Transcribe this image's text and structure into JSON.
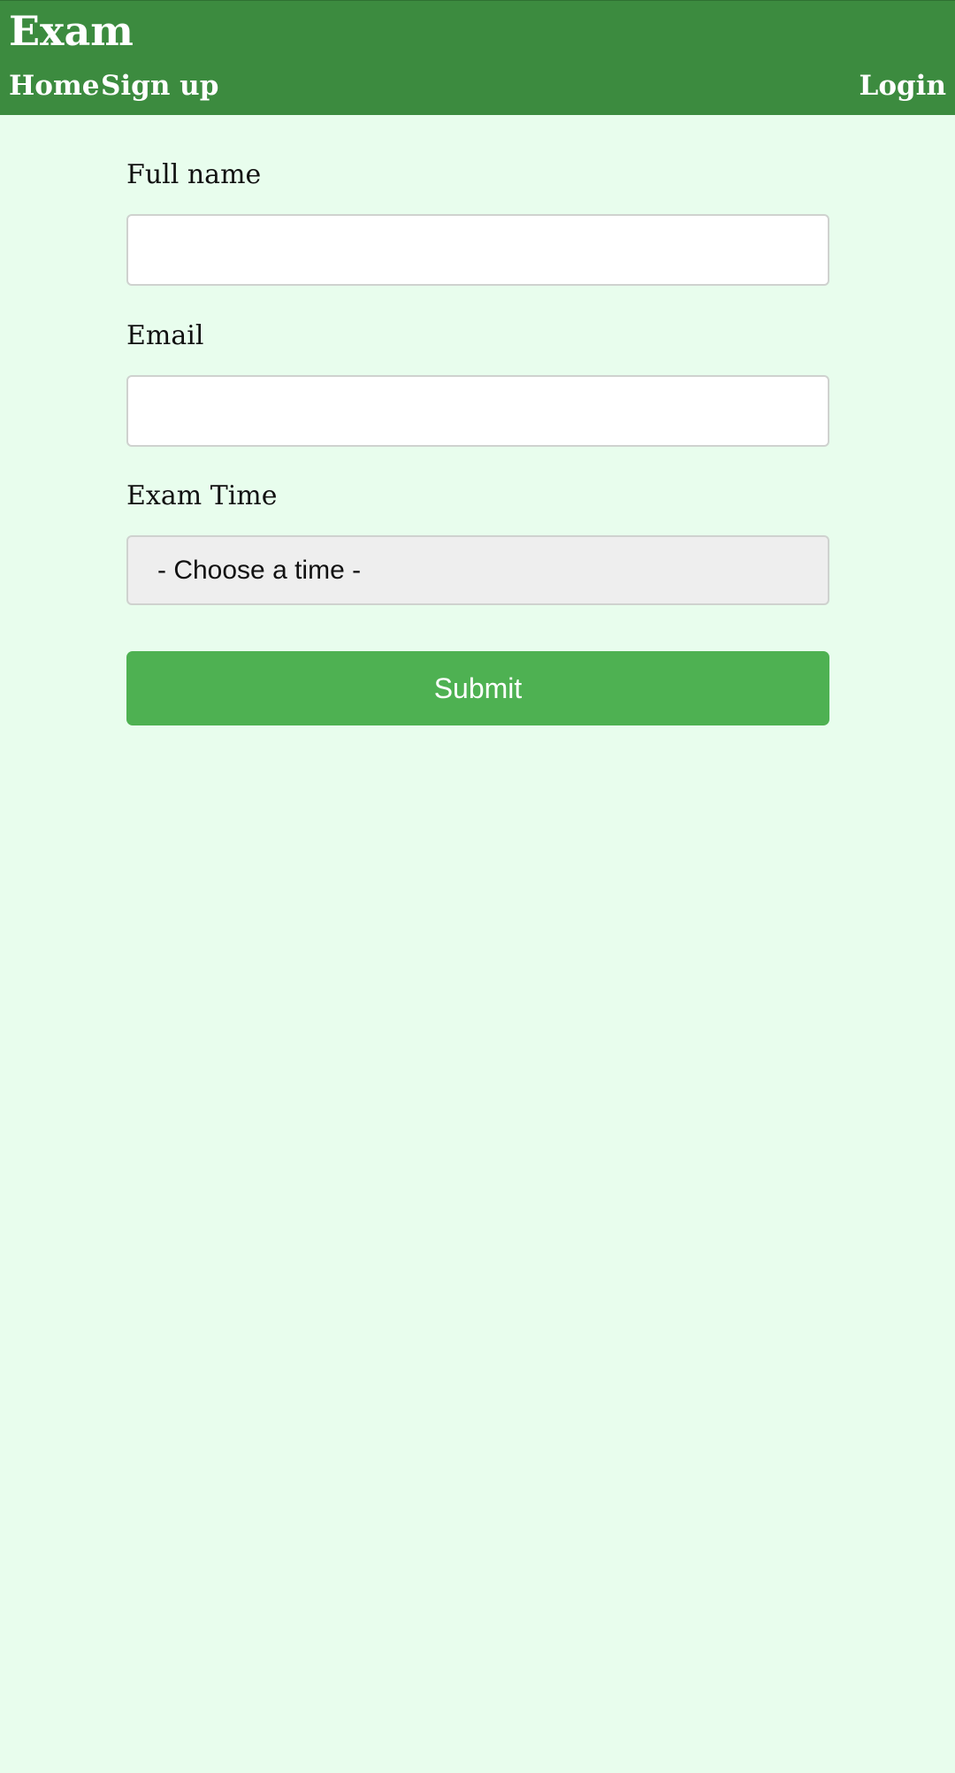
{
  "header": {
    "title": "Exam",
    "nav": {
      "home": "Home",
      "signup": "Sign up",
      "login": "Login"
    }
  },
  "form": {
    "full_name": {
      "label": "Full name",
      "value": "",
      "placeholder": ""
    },
    "email": {
      "label": "Email",
      "value": "",
      "placeholder": ""
    },
    "exam_time": {
      "label": "Exam Time",
      "selected": "- Choose a time -"
    },
    "submit_label": "Submit"
  },
  "colors": {
    "header_bg": "#3c8b3f",
    "page_bg": "#e8fded",
    "button_bg": "#4eb152"
  }
}
